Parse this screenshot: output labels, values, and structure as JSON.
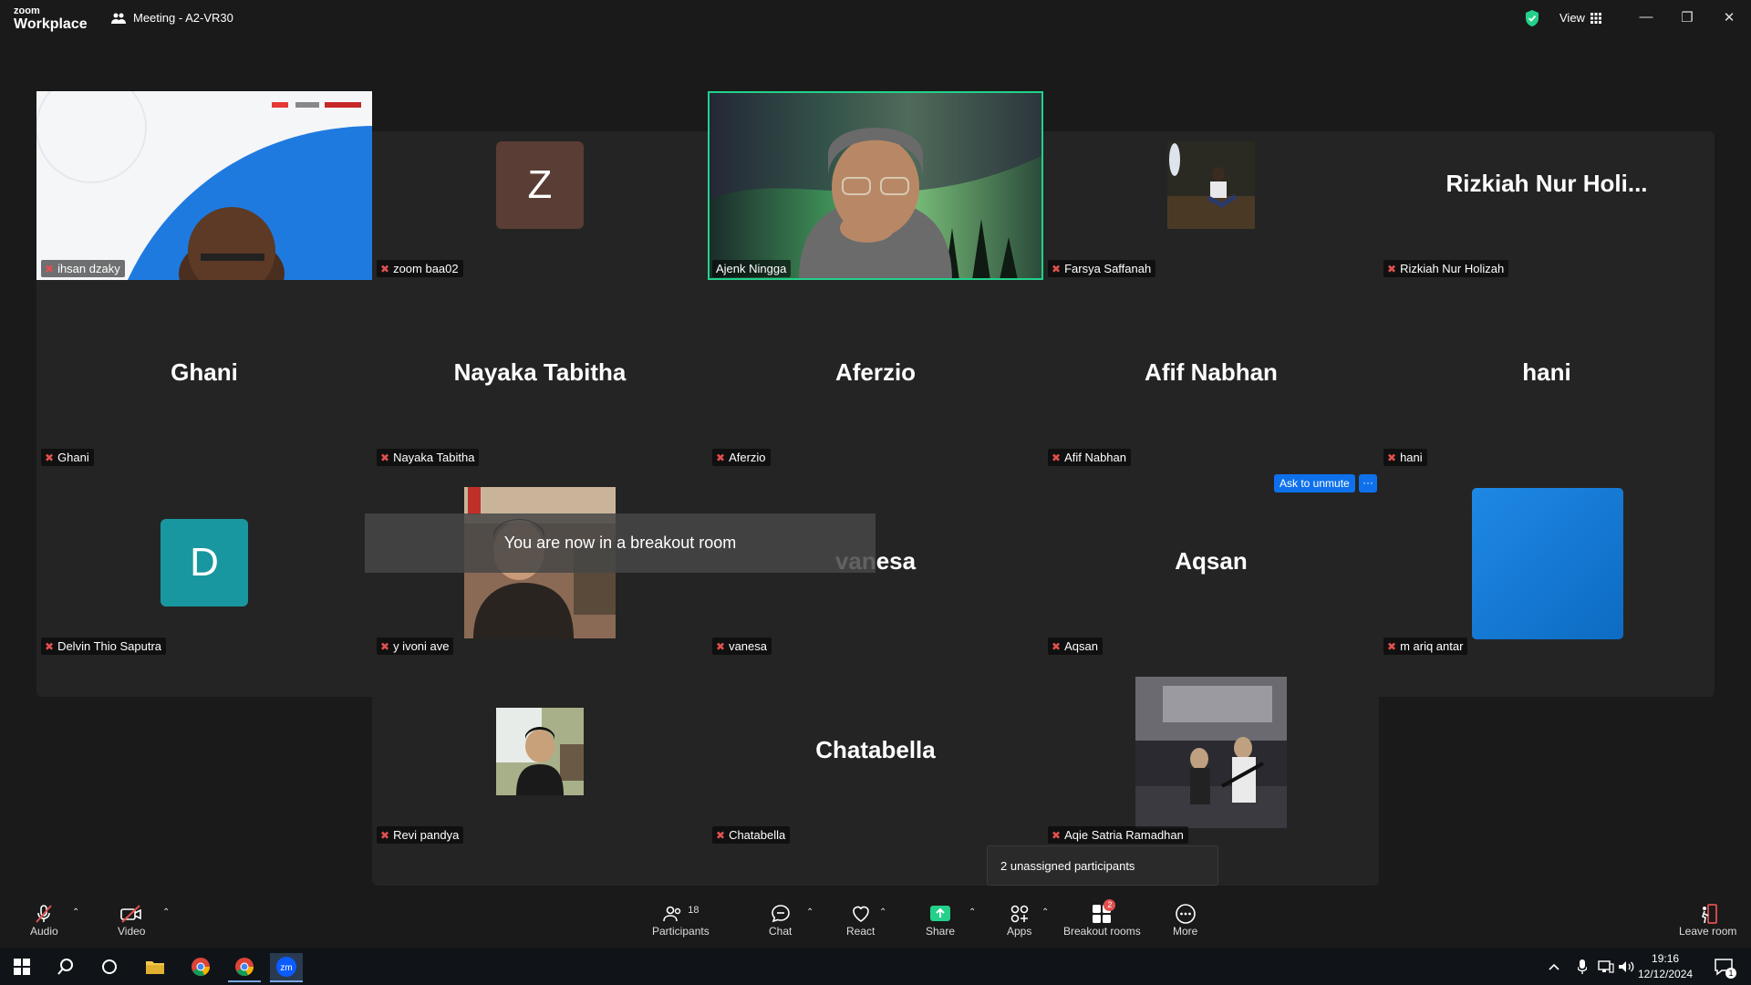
{
  "app": {
    "logo_top": "zoom",
    "logo_bottom": "Workplace",
    "meeting_title": "Meeting - A2-VR30",
    "view_label": "View"
  },
  "tiles": [
    {
      "name": "ihsan dzaky"
    },
    {
      "name": "zoom baa02",
      "avatar": "Z"
    },
    {
      "name": "Ajenk Ningga"
    },
    {
      "name": "Farsya Saffanah"
    },
    {
      "name": "Rizkiah Nur Holizah",
      "display": "Rizkiah Nur Holi..."
    },
    {
      "name": "Ghani",
      "display": "Ghani"
    },
    {
      "name": "Nayaka Tabitha",
      "display": "Nayaka Tabitha"
    },
    {
      "name": "Aferzio",
      "display": "Aferzio"
    },
    {
      "name": "Afif Nabhan",
      "display": "Afif Nabhan"
    },
    {
      "name": "hani",
      "display": "hani"
    },
    {
      "name": "Delvin Thio Saputra",
      "avatar": "D"
    },
    {
      "name": "y ivoni ave"
    },
    {
      "name": "vanesa",
      "display": "vanesa"
    },
    {
      "name": "Aqsan",
      "display": "Aqsan"
    },
    {
      "name": "m ariq antar"
    },
    {
      "name": "Revi pandya"
    },
    {
      "name": "Chatabella",
      "display": "Chatabella"
    },
    {
      "name": "Aqie Satria Ramadhan"
    }
  ],
  "ask_unmute": "Ask to unmute",
  "ask_more": "···",
  "toast": "You are now in a breakout room",
  "unassigned": "2 unassigned participants",
  "toolbar": {
    "audio": "Audio",
    "video": "Video",
    "participants": "Participants",
    "participants_count": "18",
    "chat": "Chat",
    "react": "React",
    "share": "Share",
    "apps": "Apps",
    "breakout": "Breakout rooms",
    "breakout_badge": "2",
    "more": "More",
    "leave": "Leave room"
  },
  "taskbar": {
    "time": "19:16",
    "date": "12/12/2024",
    "notif_count": "1"
  },
  "colors": {
    "accent_blue": "#0e71eb",
    "speaker_border": "#23d18b",
    "mute_red": "#e0504f",
    "share_green": "#23d18b"
  }
}
